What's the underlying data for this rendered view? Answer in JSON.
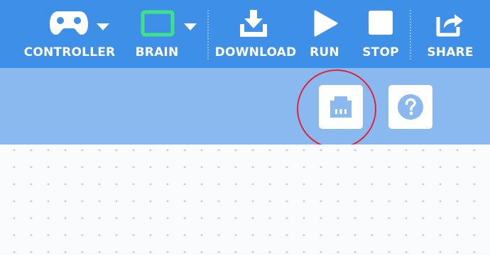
{
  "toolbar": {
    "controller_label": "CONTROLLER",
    "brain_label": "BRAIN",
    "download_label": "DOWNLOAD",
    "run_label": "RUN",
    "stop_label": "STOP",
    "share_label": "SHARE"
  },
  "colors": {
    "toolbar_bg": "#3d8fe8",
    "subbar_bg": "#8ab9ef",
    "brain_accent": "#3fe08a",
    "highlight_ring": "#e0243a"
  },
  "icons": {
    "controller": "gamepad-icon",
    "brain": "brain-device-icon",
    "download": "download-icon",
    "run": "play-icon",
    "stop": "stop-icon",
    "share": "share-icon",
    "devices": "port-icon",
    "help": "help-icon"
  }
}
